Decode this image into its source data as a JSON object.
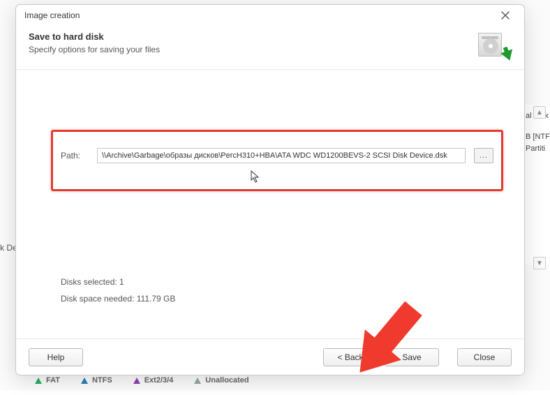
{
  "background": {
    "left_cut_label": "k Dev",
    "right_panel": {
      "line1": "al Disk",
      "line2": "B [NTFS",
      "line3": "Partiti"
    },
    "legend": {
      "fat": "FAT",
      "ntfs": "NTFS",
      "ext": "Ext2/3/4",
      "unalloc": "Unallocated"
    }
  },
  "dialog": {
    "title": "Image creation",
    "header": {
      "heading": "Save to hard disk",
      "subtitle": "Specify options for saving your files"
    },
    "path_label": "Path:",
    "path_value": "\\\\Archive\\Garbage\\образы дисков\\PercH310+HBA\\ATA WDC WD1200BEVS-2 SCSI Disk Device.dsk",
    "browse_label": "...",
    "disks_selected_label": "Disks selected:",
    "disks_selected_value": "1",
    "space_needed_label": "Disk space needed:",
    "space_needed_value": "111.79 GB",
    "buttons": {
      "help": "Help",
      "back": "< Back",
      "save": "Save",
      "close": "Close"
    }
  }
}
